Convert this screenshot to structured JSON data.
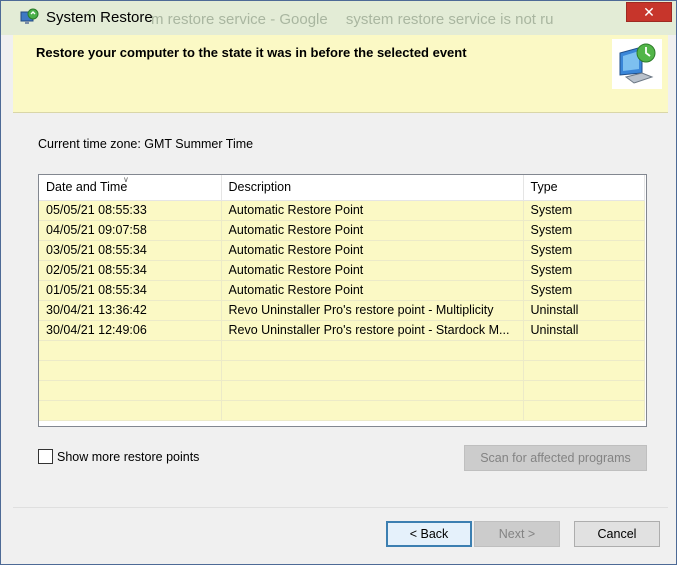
{
  "window": {
    "title": "System Restore",
    "background_tabs": [
      "m restore service - Google",
      "system restore service is not ru"
    ],
    "close_glyph": "✕"
  },
  "header": {
    "title": "Restore your computer to the state it was in before the selected event",
    "icon": "system-restore-computer-icon"
  },
  "timezone": "Current time zone: GMT Summer Time",
  "table": {
    "columns": [
      "Date and Time",
      "Description",
      "Type"
    ],
    "rows": [
      [
        "05/05/21 08:55:33",
        "Automatic Restore Point",
        "System"
      ],
      [
        "04/05/21 09:07:58",
        "Automatic Restore Point",
        "System"
      ],
      [
        "03/05/21 08:55:34",
        "Automatic Restore Point",
        "System"
      ],
      [
        "02/05/21 08:55:34",
        "Automatic Restore Point",
        "System"
      ],
      [
        "01/05/21 08:55:34",
        "Automatic Restore Point",
        "System"
      ],
      [
        "30/04/21 13:36:42",
        "Revo Uninstaller Pro's restore point - Multiplicity",
        "Uninstall"
      ],
      [
        "30/04/21 12:49:06",
        "Revo Uninstaller Pro's restore point - Stardock M...",
        "Uninstall"
      ]
    ],
    "empty_rows": 4
  },
  "show_more": {
    "label": "Show more restore points",
    "checked": false
  },
  "buttons": {
    "scan": "Scan for affected programs",
    "back": "< Back",
    "next": "Next >",
    "cancel": "Cancel"
  },
  "colors": {
    "header_bg": "#fbf9c5",
    "close_red": "#c7352b",
    "focus_blue": "#3c7fb1"
  }
}
